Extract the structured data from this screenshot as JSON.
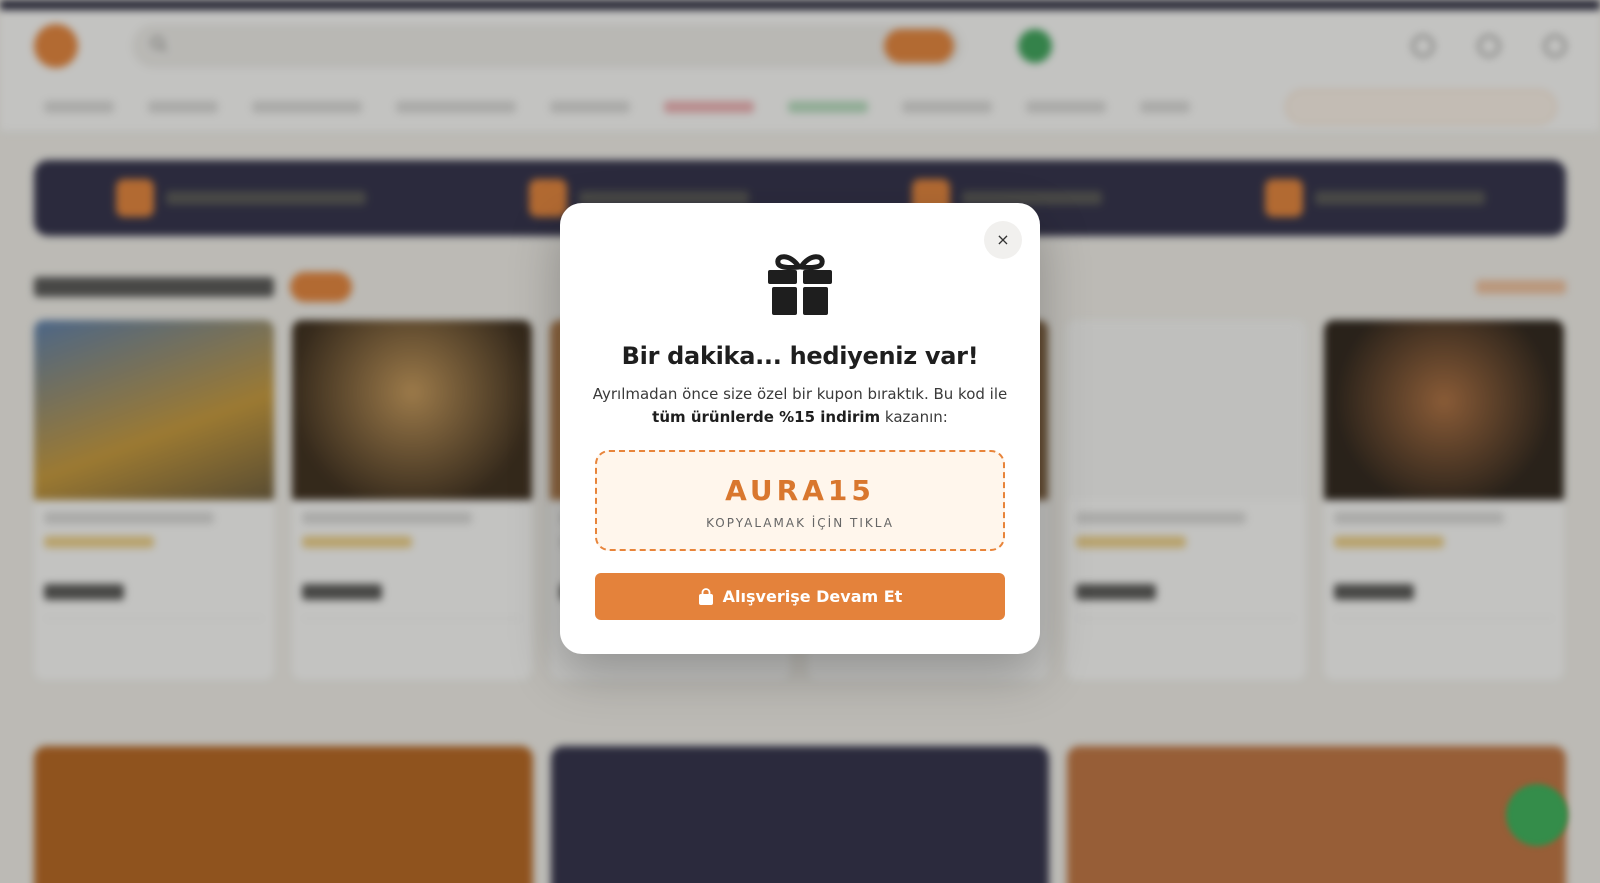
{
  "modal": {
    "close_symbol": "×",
    "icon": "gift-icon",
    "title": "Bir dakika... hediyeniz var!",
    "desc_part1": "Ayrılmadan önce size özel bir kupon bıraktık. Bu kod ile ",
    "desc_bold": "tüm ürünlerde %15 indirim",
    "desc_part2": " kazanın:",
    "coupon_code": "AURA15",
    "coupon_hint": "KOPYALAMAK İÇİN TIKLA",
    "cta_label": "Alışverişe Devam Et",
    "cta_icon": "shopping-bag-icon"
  },
  "colors": {
    "accent": "#e4823b",
    "coupon_bg": "#fff6ec",
    "navy": "#2d2c48",
    "whatsapp": "#39b45a"
  }
}
